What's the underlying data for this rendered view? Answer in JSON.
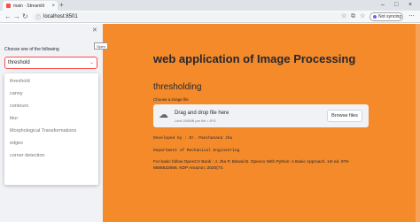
{
  "browser": {
    "tab_title": "main · Streamlit",
    "address": "localhost:8501",
    "sync_label": "Not syncing"
  },
  "sidebar": {
    "select_label": "Choose one of the following",
    "selected": "threshold",
    "tooltip": "Open",
    "options": [
      "threshold",
      "canny",
      "contours",
      "blur",
      "Morphological Transformations",
      "edges",
      "corner detection"
    ]
  },
  "main": {
    "title": "web application of Image Processing",
    "subtitle": "thresholding",
    "upload_label": "Choose a image file",
    "drag_text": "Drag and drop file here",
    "limit_text": "Limit 200MB per file • JPG",
    "browse_label": "Browse files",
    "developed_by": "Developed by : Dr. Panchanand Jha",
    "department": "Department of Mechanical Engineering",
    "reference": "For basic follow OpenCV Book : J. Jha P, Biswal B. Opencv With Python: A Basic Approach. 1st ed. 979-8686832666. KDP Amazon; 2020(74."
  },
  "colors": {
    "main_bg": "#f48a2a",
    "sidebar_bg": "#f0f2f6",
    "accent": "#ff4b4b"
  },
  "icons": {
    "upload": "cloud-upload-icon",
    "close": "close-icon",
    "chevron": "chevron-down-icon"
  }
}
